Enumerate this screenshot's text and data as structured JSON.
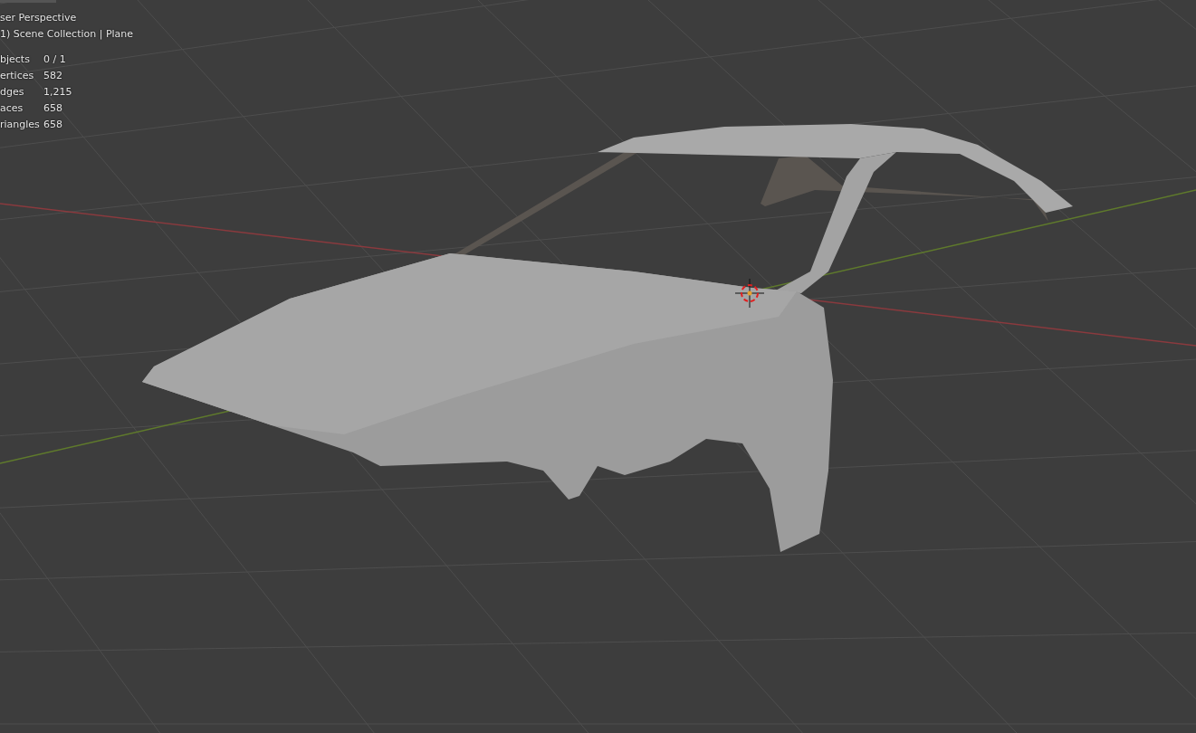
{
  "viewport": {
    "view_name": "ser Perspective",
    "collection": "1) Scene Collection | Plane",
    "stats": [
      {
        "label": "bjects",
        "value": "0 / 1"
      },
      {
        "label": "ertices",
        "value": "582"
      },
      {
        "label": "dges",
        "value": "1,215"
      },
      {
        "label": "aces",
        "value": "658"
      },
      {
        "label": "riangles",
        "value": "658"
      }
    ]
  }
}
